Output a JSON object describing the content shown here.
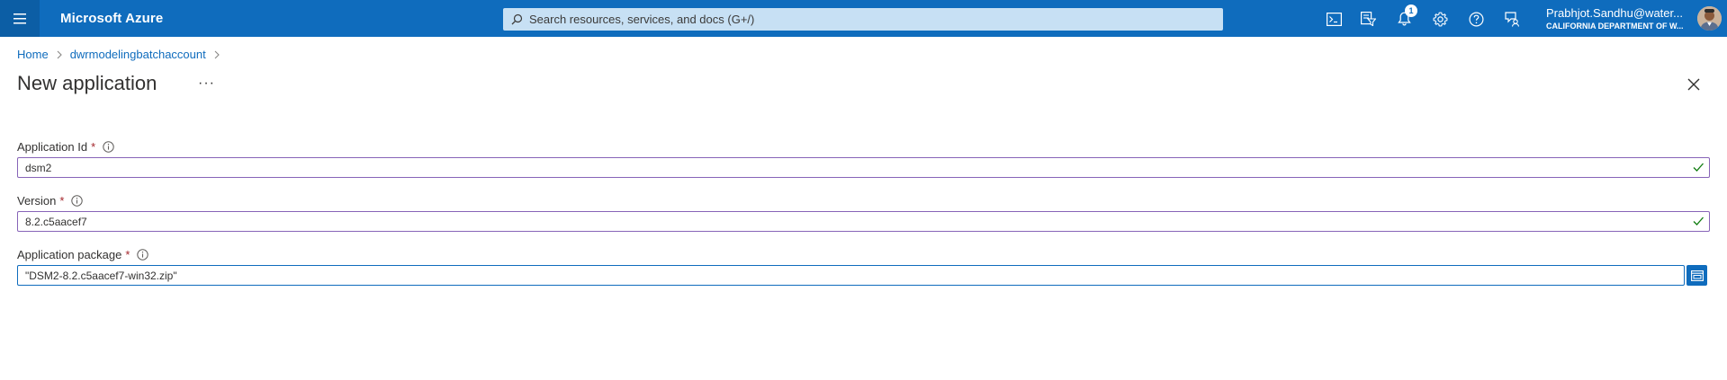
{
  "header": {
    "brand": "Microsoft Azure",
    "search_placeholder": "Search resources, services, and docs (G+/)",
    "notification_count": "1",
    "account_name": "Prabhjot.Sandhu@water...",
    "account_org": "CALIFORNIA DEPARTMENT OF W..."
  },
  "breadcrumb": {
    "items": [
      "Home",
      "dwrmodelingbatchaccount"
    ]
  },
  "page": {
    "title": "New application",
    "more_label": "···"
  },
  "form": {
    "fields": [
      {
        "label": "Application Id",
        "required_mark": "*",
        "value": "dsm2"
      },
      {
        "label": "Version",
        "required_mark": "*",
        "value": "8.2.c5aacef7"
      },
      {
        "label": "Application package",
        "required_mark": "*",
        "value": "\"DSM2-8.2.c5aacef7-win32.zip\""
      }
    ]
  },
  "colors": {
    "header_bg": "#0f6cbd",
    "link": "#0f6cbd",
    "valid_border": "#8764b8",
    "valid_check": "#107c10",
    "required": "#a4262c"
  },
  "icons": {
    "menu": "hamburger-icon",
    "search": "search-icon",
    "cloud_shell": "cloud-shell-icon",
    "directory": "directory-filter-icon",
    "notifications": "bell-icon",
    "settings": "gear-icon",
    "help": "help-icon",
    "feedback": "feedback-icon",
    "close": "close-icon",
    "info": "info-icon",
    "valid": "check-icon",
    "browse": "folder-open-icon"
  }
}
